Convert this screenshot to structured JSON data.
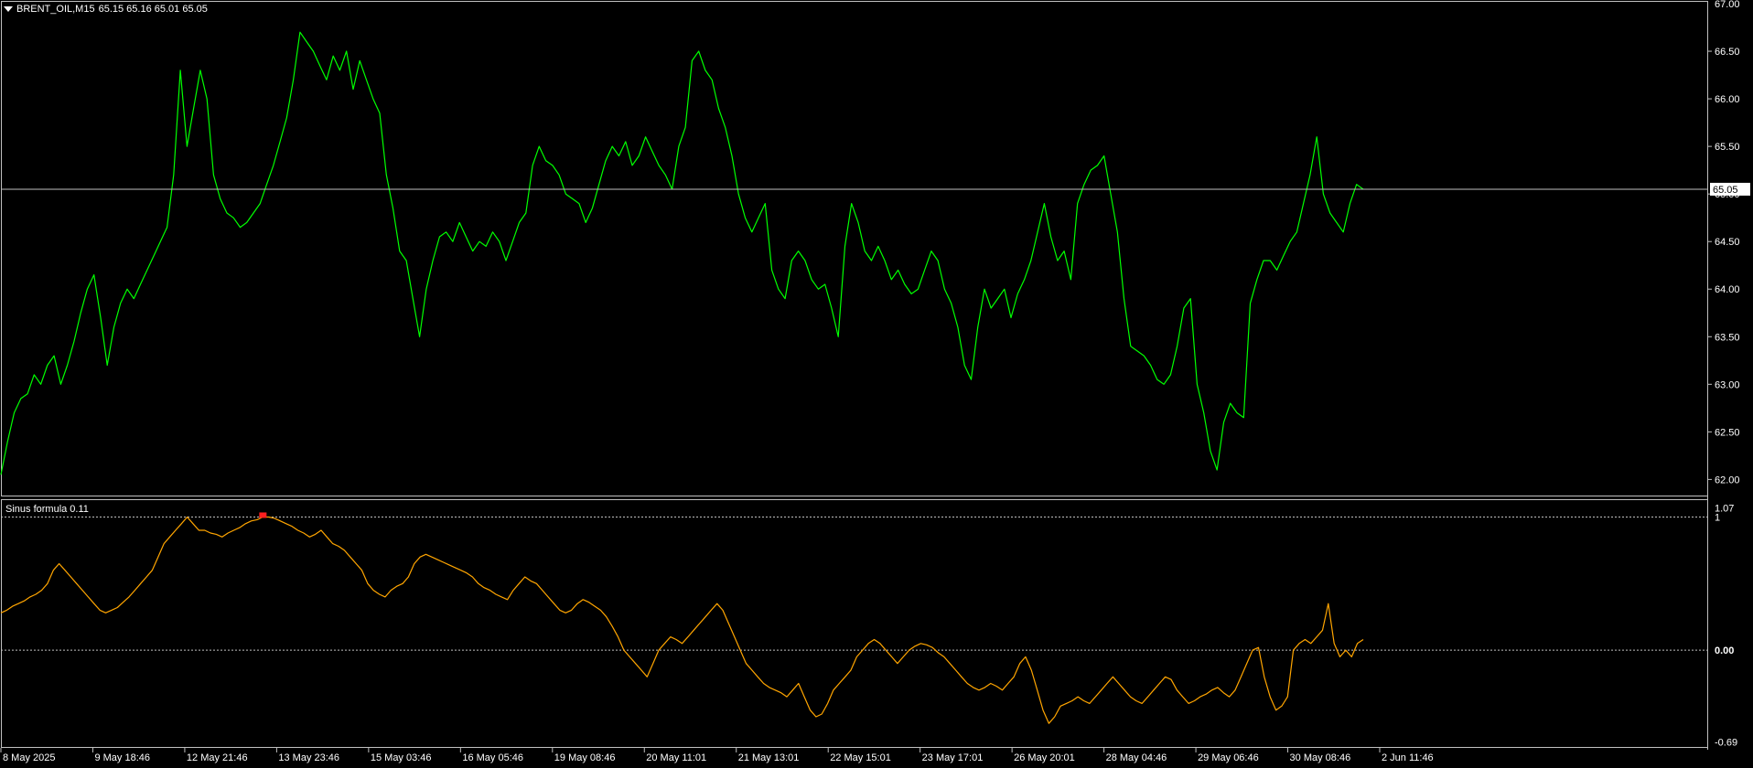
{
  "header": {
    "symbol": "BRENT_OIL,M15",
    "ohlc": "65.15 65.16 65.01 65.05"
  },
  "indicator": {
    "name": "Sinus formula 0.11"
  },
  "colors": {
    "background": "#000000",
    "price_line": "#00ff00",
    "indicator_line": "#ffa500",
    "grid": "#c0c0c0",
    "axis_text": "#ffffff",
    "current_price_bg": "#ffffff",
    "current_price_text": "#000000",
    "marker": "#ff2020"
  },
  "chart_data": [
    {
      "type": "line",
      "panel": "price",
      "series": [
        {
          "values": [
            62.05,
            62.4,
            62.7,
            62.85,
            62.9,
            63.1,
            63.0,
            63.2,
            63.3,
            63.0,
            63.2,
            63.45,
            63.75,
            64.0,
            64.15,
            63.7,
            63.2,
            63.6,
            63.85,
            64.0,
            63.9,
            64.05,
            64.2,
            64.35,
            64.5,
            64.65,
            65.2,
            66.3,
            65.5,
            65.9,
            66.3,
            66.0,
            65.2,
            64.95,
            64.8,
            64.75,
            64.65,
            64.7,
            64.8,
            64.9,
            65.1,
            65.3,
            65.55,
            65.8,
            66.2,
            66.7,
            66.6,
            66.5,
            66.35,
            66.2,
            66.45,
            66.3,
            66.5,
            66.1,
            66.4,
            66.2,
            66.0,
            65.85,
            65.2,
            64.85,
            64.4,
            64.3,
            63.9,
            63.5,
            64.0,
            64.3,
            64.55,
            64.6,
            64.5,
            64.7,
            64.55,
            64.4,
            64.5,
            64.45,
            64.6,
            64.5,
            64.3,
            64.5,
            64.7,
            64.8,
            65.3,
            65.5,
            65.35,
            65.3,
            65.2,
            65.0,
            64.95,
            64.9,
            64.7,
            64.85,
            65.1,
            65.35,
            65.5,
            65.4,
            65.55,
            65.3,
            65.4,
            65.6,
            65.45,
            65.3,
            65.2,
            65.05,
            65.5,
            65.7,
            66.4,
            66.5,
            66.3,
            66.2,
            65.9,
            65.7,
            65.4,
            65.0,
            64.75,
            64.6,
            64.75,
            64.9,
            64.2,
            64.0,
            63.9,
            64.3,
            64.4,
            64.3,
            64.1,
            64.0,
            64.05,
            63.8,
            63.5,
            64.45,
            64.9,
            64.7,
            64.4,
            64.3,
            64.45,
            64.3,
            64.1,
            64.2,
            64.05,
            63.95,
            64.0,
            64.2,
            64.4,
            64.3,
            64.0,
            63.85,
            63.6,
            63.2,
            63.05,
            63.6,
            64.0,
            63.8,
            63.9,
            64.0,
            63.7,
            63.95,
            64.1,
            64.3,
            64.6,
            64.9,
            64.55,
            64.3,
            64.4,
            64.1,
            64.9,
            65.1,
            65.25,
            65.3,
            65.4,
            65.0,
            64.6,
            63.9,
            63.4,
            63.35,
            63.3,
            63.2,
            63.05,
            63.0,
            63.1,
            63.4,
            63.8,
            63.9,
            63.0,
            62.7,
            62.3,
            62.1,
            62.6,
            62.8,
            62.7,
            62.65,
            63.85,
            64.1,
            64.3,
            64.3,
            64.2,
            64.35,
            64.5,
            64.6,
            64.9,
            65.2,
            65.6,
            65.0,
            64.8,
            64.7,
            64.6,
            64.9,
            65.1,
            65.05
          ]
        }
      ],
      "ylim": [
        61.85,
        67.0
      ],
      "yticks": [
        "67.00",
        "66.50",
        "66.00",
        "65.50",
        "65.00",
        "64.50",
        "64.00",
        "63.50",
        "63.00",
        "62.50",
        "62.00"
      ],
      "current_price": "65.05",
      "current_price_value": 65.05
    },
    {
      "type": "line",
      "panel": "indicator",
      "title": "Sinus formula 0.11",
      "series": [
        {
          "values": [
            0.28,
            0.3,
            0.33,
            0.35,
            0.37,
            0.4,
            0.42,
            0.45,
            0.5,
            0.6,
            0.65,
            0.6,
            0.55,
            0.5,
            0.45,
            0.4,
            0.35,
            0.3,
            0.28,
            0.3,
            0.32,
            0.36,
            0.4,
            0.45,
            0.5,
            0.55,
            0.6,
            0.7,
            0.8,
            0.85,
            0.9,
            0.95,
            1.0,
            0.95,
            0.9,
            0.9,
            0.88,
            0.87,
            0.85,
            0.88,
            0.9,
            0.92,
            0.95,
            0.97,
            0.98,
            1.0,
            1.0,
            0.99,
            0.97,
            0.95,
            0.93,
            0.9,
            0.88,
            0.85,
            0.87,
            0.9,
            0.85,
            0.8,
            0.78,
            0.75,
            0.7,
            0.65,
            0.6,
            0.5,
            0.45,
            0.42,
            0.4,
            0.45,
            0.48,
            0.5,
            0.55,
            0.65,
            0.7,
            0.72,
            0.7,
            0.68,
            0.66,
            0.64,
            0.62,
            0.6,
            0.58,
            0.55,
            0.5,
            0.47,
            0.45,
            0.42,
            0.4,
            0.38,
            0.45,
            0.5,
            0.55,
            0.52,
            0.5,
            0.45,
            0.4,
            0.35,
            0.3,
            0.28,
            0.3,
            0.35,
            0.38,
            0.36,
            0.33,
            0.3,
            0.25,
            0.18,
            0.1,
            0.0,
            -0.05,
            -0.1,
            -0.15,
            -0.2,
            -0.1,
            0.0,
            0.05,
            0.1,
            0.08,
            0.05,
            0.1,
            0.15,
            0.2,
            0.25,
            0.3,
            0.35,
            0.3,
            0.2,
            0.1,
            0.0,
            -0.1,
            -0.15,
            -0.2,
            -0.25,
            -0.28,
            -0.3,
            -0.32,
            -0.35,
            -0.3,
            -0.25,
            -0.35,
            -0.45,
            -0.5,
            -0.48,
            -0.4,
            -0.3,
            -0.25,
            -0.2,
            -0.15,
            -0.05,
            0.0,
            0.05,
            0.08,
            0.05,
            0.0,
            -0.05,
            -0.1,
            -0.05,
            0.0,
            0.03,
            0.05,
            0.04,
            0.02,
            -0.02,
            -0.05,
            -0.1,
            -0.15,
            -0.2,
            -0.25,
            -0.28,
            -0.3,
            -0.28,
            -0.25,
            -0.27,
            -0.3,
            -0.25,
            -0.2,
            -0.1,
            -0.05,
            -0.15,
            -0.3,
            -0.45,
            -0.55,
            -0.5,
            -0.42,
            -0.4,
            -0.38,
            -0.35,
            -0.38,
            -0.4,
            -0.35,
            -0.3,
            -0.25,
            -0.2,
            -0.25,
            -0.3,
            -0.35,
            -0.38,
            -0.4,
            -0.35,
            -0.3,
            -0.25,
            -0.2,
            -0.22,
            -0.3,
            -0.35,
            -0.4,
            -0.38,
            -0.35,
            -0.33,
            -0.3,
            -0.28,
            -0.32,
            -0.35,
            -0.3,
            -0.2,
            -0.1,
            0.0,
            0.02,
            -0.2,
            -0.35,
            -0.45,
            -0.42,
            -0.35,
            0.0,
            0.05,
            0.08,
            0.05,
            0.1,
            0.15,
            0.35,
            0.05,
            -0.05,
            0.0,
            -0.05,
            0.05,
            0.08
          ]
        }
      ],
      "ylim": [
        -0.72,
        1.12
      ],
      "yticks": [
        "1.07",
        "1",
        "0.00",
        "-0.69"
      ],
      "levels": [
        1.0,
        0.0
      ],
      "marker": {
        "index": 45,
        "value": 1.0
      }
    }
  ],
  "xaxis": {
    "labels": [
      "8 May 2025",
      "9 May 18:46",
      "12 May 21:46",
      "13 May 23:46",
      "15 May 03:46",
      "16 May 05:46",
      "19 May 08:46",
      "20 May 11:01",
      "21 May 13:01",
      "22 May 15:01",
      "23 May 17:01",
      "26 May 20:01",
      "28 May 04:46",
      "29 May 06:46",
      "30 May 08:46",
      "2 Jun 11:46"
    ]
  }
}
